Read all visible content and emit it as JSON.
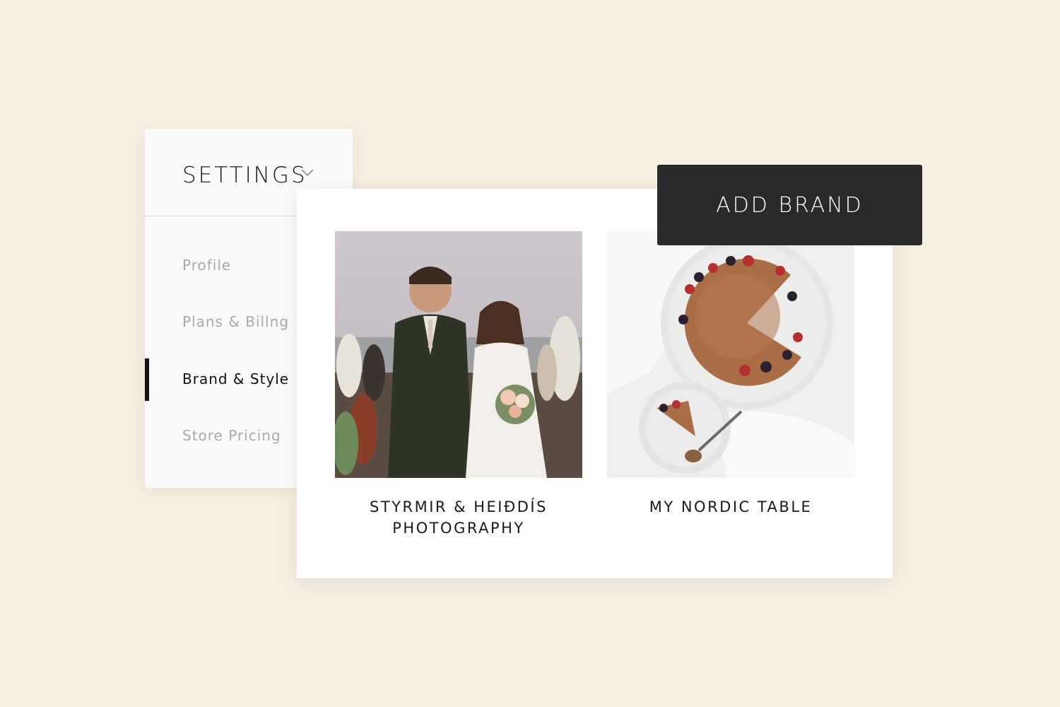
{
  "settings": {
    "title": "SETTINGS",
    "dropdown_icon": "chevron-down-icon",
    "menu": [
      {
        "label": "Profile",
        "active": false
      },
      {
        "label": "Plans & Billng",
        "active": false
      },
      {
        "label": "Brand & Style",
        "active": true
      },
      {
        "label": "Store Pricing",
        "active": false
      }
    ]
  },
  "brands": [
    {
      "name_line1": "STYRMIR & HEIÐDÍS",
      "name_line2": "PHOTOGRAPHY",
      "image": "wedding-couple-photo"
    },
    {
      "name_line1": "MY NORDIC TABLE",
      "name_line2": "",
      "image": "chocolate-cake-photo"
    }
  ],
  "add_brand_button": {
    "label": "ADD BRAND"
  },
  "colors": {
    "background": "#f6efe1",
    "panel": "#fafafa",
    "card": "#ffffff",
    "button": "#2a2a2a",
    "active_text": "#111111",
    "inactive_text": "#a9a9a9"
  }
}
